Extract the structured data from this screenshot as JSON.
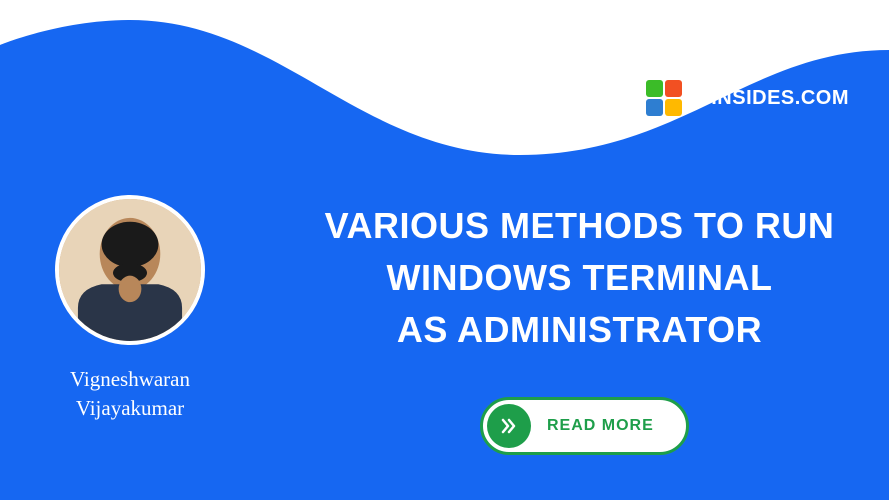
{
  "brand": {
    "name": "WINSIDES.COM"
  },
  "author": {
    "name_line1": "Vigneshwaran",
    "name_line2": "Vijayakumar"
  },
  "headline": {
    "line1": "VARIOUS METHODS TO RUN",
    "line2": "WINDOWS TERMINAL",
    "line3": "AS ADMINISTRATOR"
  },
  "cta": {
    "label": "READ MORE"
  }
}
